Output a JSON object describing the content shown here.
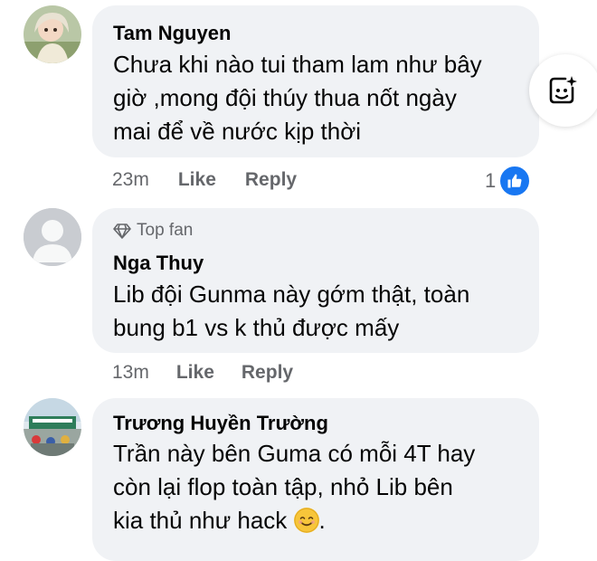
{
  "comments": [
    {
      "author": "Tam Nguyen",
      "text": "Chưa khi nào tui tham lam như bây\ngiờ ,mong đội thúy thua nốt ngày\nmai để về nước kịp thời",
      "time": "23m",
      "like_label": "Like",
      "reply_label": "Reply",
      "reaction_count": "1"
    },
    {
      "badge": "Top fan",
      "author": "Nga Thuy",
      "text": "Lib đội Gunma này gớm thật, toàn\nbung b1 vs k thủ được mấy",
      "time": "13m",
      "like_label": "Like",
      "reply_label": "Reply"
    },
    {
      "author": "Trương Huyền Trường",
      "text_before_emoji": "Trần này bên Guma có mỗi 4T hay\ncòn lại flop toàn tập, nhỏ Lib bên\nkia thủ như hack ",
      "text_after_emoji": ".",
      "emoji": "smiling-face-emoji"
    }
  ],
  "icons": {
    "sticker": "sticker-icon",
    "reaction": "thumbs-up-icon",
    "top_fan": "diamond-icon"
  },
  "colors": {
    "bubble": "#f0f2f5",
    "meta_text": "#65676b",
    "like_blue": "#1877f2"
  }
}
